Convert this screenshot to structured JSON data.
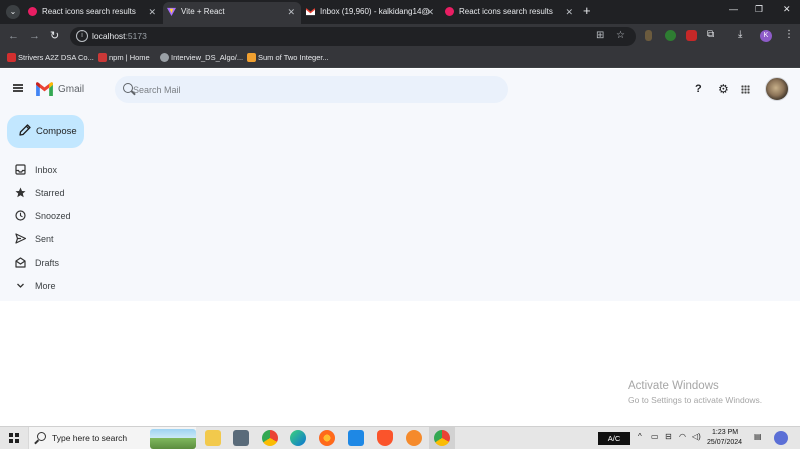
{
  "browser": {
    "tabs": [
      {
        "title": "React icons search results",
        "active": false,
        "favicon": "react-icons-favicon"
      },
      {
        "title": "Vite + React",
        "active": true,
        "favicon": "vite-favicon"
      },
      {
        "title": "Inbox (19,960) - kalkidang14@",
        "active": false,
        "favicon": "gmail-favicon"
      },
      {
        "title": "React icons search results",
        "active": false,
        "favicon": "react-icons-favicon"
      }
    ],
    "new_tab": "+",
    "close_glyph": "✕",
    "url_host": "localhost",
    "url_port": ":5173",
    "bookmarks": [
      {
        "label": "Strivers A2Z DSA Co..."
      },
      {
        "label": "npm | Home"
      },
      {
        "label": "Interview_DS_Algo/..."
      },
      {
        "label": "Sum of Two Integer..."
      }
    ],
    "profile_initial": "K"
  },
  "gmail": {
    "brand": "Gmail",
    "search_placeholder": "Search Mail",
    "help_label": "?",
    "compose_label": "Compose",
    "nav": [
      {
        "label": "Inbox",
        "icon": "inbox-icon"
      },
      {
        "label": "Starred",
        "icon": "star-icon"
      },
      {
        "label": "Snoozed",
        "icon": "clock-icon"
      },
      {
        "label": "Sent",
        "icon": "send-icon"
      },
      {
        "label": "Drafts",
        "icon": "drafts-icon"
      },
      {
        "label": "More",
        "icon": "chevron-down-icon"
      }
    ],
    "colors": {
      "compose_bg": "#c2e7ff",
      "page_bg": "#f6f8fc",
      "search_bg": "#eaf1fb"
    }
  },
  "watermark": {
    "line1": "Activate Windows",
    "line2": "Go to Settings to activate Windows."
  },
  "taskbar": {
    "search_text": "Type here to search",
    "ac_label": "A/C",
    "time": "1:23 PM",
    "date": "25/07/2024"
  }
}
